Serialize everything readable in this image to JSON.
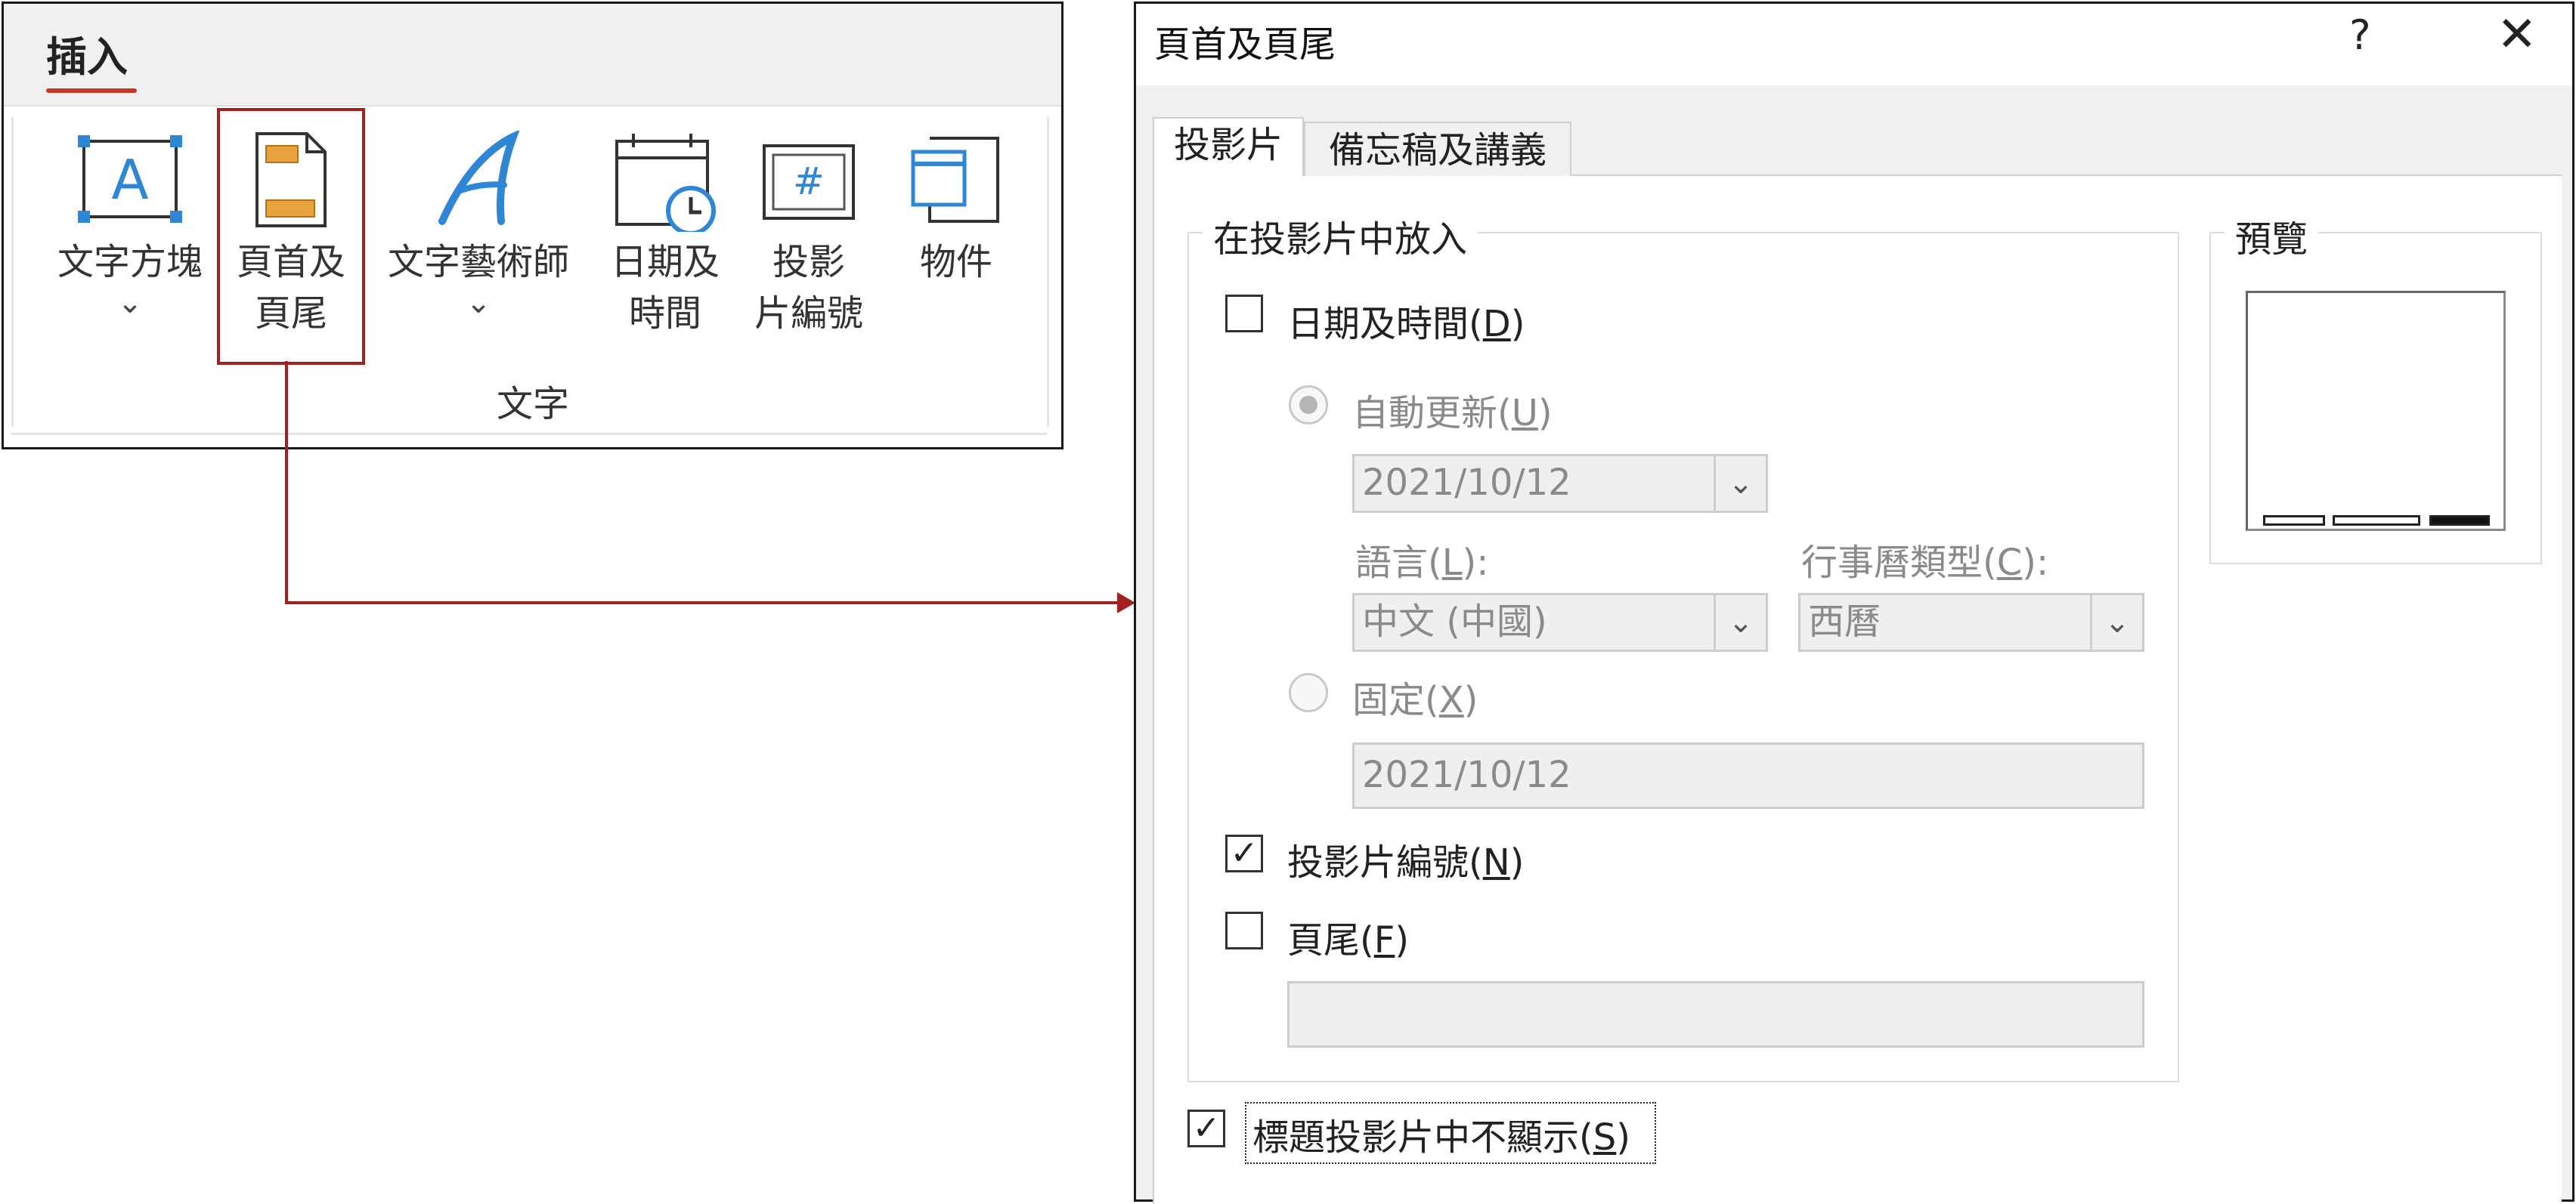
{
  "ribbon": {
    "tab_label": "插入",
    "group_label": "文字",
    "items": [
      {
        "label": "文字方塊",
        "icon": "textbox-icon",
        "has_dropdown": true
      },
      {
        "label_line1": "頁首及",
        "label_line2": "頁尾",
        "icon": "header-footer-icon",
        "highlighted": true
      },
      {
        "label": "文字藝術師",
        "icon": "wordart-icon",
        "has_dropdown": true
      },
      {
        "label_line1": "日期及",
        "label_line2": "時間",
        "icon": "date-time-icon"
      },
      {
        "label_line1": "投影",
        "label_line2": "片編號",
        "icon": "slide-number-icon"
      },
      {
        "label": "物件",
        "icon": "object-icon"
      }
    ],
    "dropdown_glyph": "⌄"
  },
  "dialog": {
    "title": "頁首及頁尾",
    "help_glyph": "?",
    "close_glyph": "✕",
    "tabs": [
      {
        "label": "投影片",
        "active": true
      },
      {
        "label": "備忘稿及講義",
        "active": false
      }
    ],
    "include_group": {
      "title": "在投影片中放入",
      "date_time": {
        "label": "日期及時間",
        "accel": "D",
        "checked": false
      },
      "auto_update": {
        "label": "自動更新",
        "accel": "U",
        "selected": true,
        "enabled": false
      },
      "auto_date_value": "2021/10/12",
      "language": {
        "label": "語言",
        "accel": "L",
        "suffix": ":",
        "value": "中文 (中國)"
      },
      "calendar": {
        "label": "行事曆類型",
        "accel": "C",
        "suffix": ":",
        "value": "西曆"
      },
      "fixed": {
        "label": "固定",
        "accel": "X",
        "selected": false,
        "enabled": false
      },
      "fixed_date_value": "2021/10/12",
      "slide_number": {
        "label": "投影片編號",
        "accel": "N",
        "checked": true
      },
      "footer": {
        "label": "頁尾",
        "accel": "F",
        "checked": false,
        "value": ""
      }
    },
    "preview": {
      "title": "預覽"
    },
    "dont_show_title": {
      "label": "標題投影片中不顯示",
      "accel": "S",
      "checked": true
    },
    "check_glyph": "✓"
  },
  "colors": {
    "highlight_red": "#a32020",
    "accent_blue": "#2e86d4",
    "accent_orange": "#e8a33d"
  }
}
